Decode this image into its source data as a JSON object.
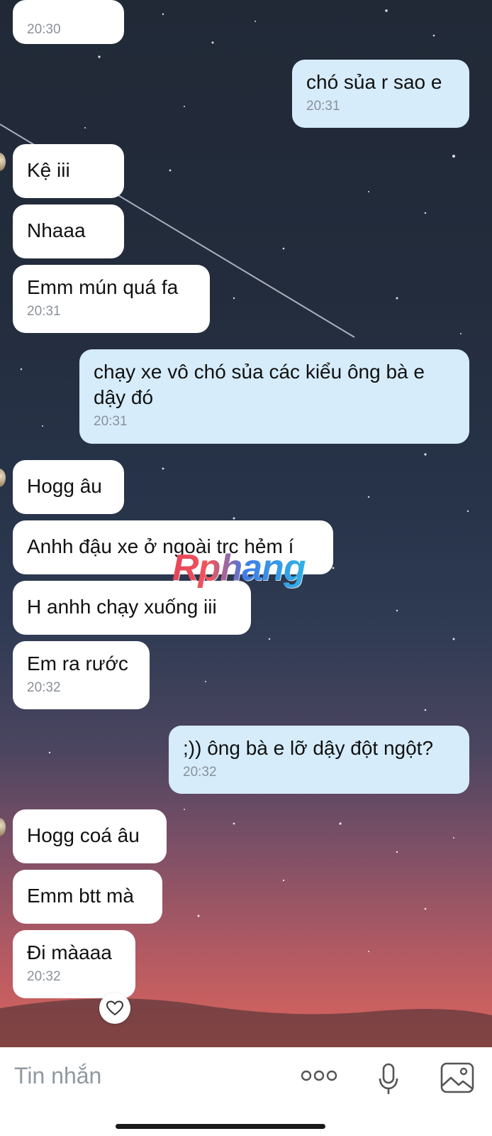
{
  "messages": [
    {
      "side": "them",
      "text": "",
      "time": "20:30"
    },
    {
      "side": "me",
      "text": "chó sủa r sao e",
      "time": "20:31"
    },
    {
      "side": "them",
      "text": "Kệ iii",
      "time": ""
    },
    {
      "side": "them",
      "text": "Nhaaa",
      "time": ""
    },
    {
      "side": "them",
      "text": "Emm mún quá fa",
      "time": "20:31"
    },
    {
      "side": "me",
      "text": "chạy xe vô chó sủa các kiểu ông bà e dậy đó",
      "time": "20:31"
    },
    {
      "side": "them",
      "text": "Hogg âu",
      "time": ""
    },
    {
      "side": "them",
      "text": "Anhh đậu xe ở ngoài trc hẻm í",
      "time": ""
    },
    {
      "side": "them",
      "text": "H anhh chạy xuống iii",
      "time": ""
    },
    {
      "side": "them",
      "text": "Em ra rước",
      "time": "20:32"
    },
    {
      "side": "me",
      "text": ";)) ông bà e lỡ dậy đột ngột?",
      "time": "20:32"
    },
    {
      "side": "them",
      "text": "Hogg coá âu",
      "time": ""
    },
    {
      "side": "them",
      "text": "Emm btt mà",
      "time": ""
    },
    {
      "side": "them",
      "text": "Đi màaaa",
      "time": "20:32"
    }
  ],
  "watermark": "Rphang",
  "composer": {
    "placeholder": "Tin nhắn",
    "icons": [
      "more-icon",
      "microphone-icon",
      "image-icon"
    ]
  },
  "reaction_icon": "heart-icon",
  "colors": {
    "incoming": "#ffffff",
    "outgoing": "#d6ecfb",
    "timestamp": "#8a9099"
  }
}
